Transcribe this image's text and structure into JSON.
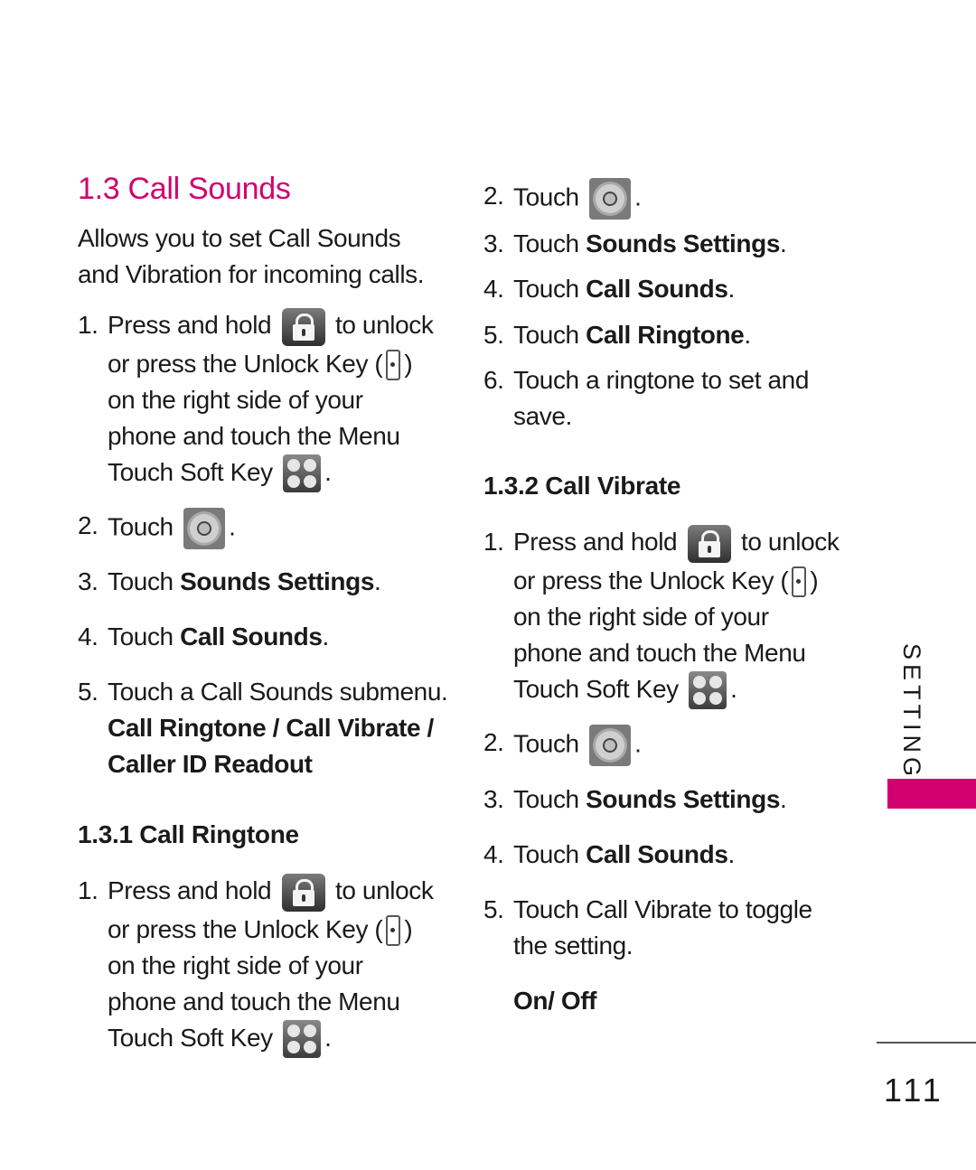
{
  "page": {
    "title": "1.3 Call Sounds",
    "intro": [
      "Allows you to set Call Sounds",
      "and Vibration for incoming calls."
    ],
    "left_steps": {
      "s1": {
        "num": "1.",
        "a": "Press and hold",
        "b": "to unlock",
        "c": "or press the Unlock Key (",
        "d": ")",
        "e": "on the right side of your",
        "f": "phone and touch the Menu",
        "g": "Touch Soft Key",
        "h": "."
      },
      "s2": {
        "num": "2.",
        "text": "Touch",
        "end": "."
      },
      "s3": {
        "num": "3.",
        "pre": "Touch ",
        "bold": "Sounds Settings",
        "end": "."
      },
      "s4": {
        "num": "4.",
        "pre": "Touch ",
        "bold": "Call Sounds",
        "end": "."
      },
      "s5": {
        "num": "5.",
        "text": "Touch a Call Sounds submenu.",
        "bold1": "Call Ringtone / Call Vibrate /",
        "bold2": "Caller ID Readout"
      }
    },
    "sub1": {
      "title": "1.3.1 Call Ringtone",
      "s1": {
        "num": "1.",
        "a": "Press and hold",
        "b": "to unlock",
        "c": "or press the Unlock Key (",
        "d": ")",
        "e": "on the right side of your",
        "f": "phone and touch the Menu",
        "g": "Touch Soft Key",
        "h": "."
      },
      "s2": {
        "num": "2.",
        "text": "Touch",
        "end": "."
      },
      "s3": {
        "num": "3.",
        "pre": "Touch ",
        "bold": "Sounds Settings",
        "end": "."
      },
      "s4": {
        "num": "4.",
        "pre": "Touch ",
        "bold": "Call Sounds",
        "end": "."
      },
      "s5": {
        "num": "5.",
        "pre": "Touch ",
        "bold": "Call Ringtone",
        "end": "."
      },
      "s6": {
        "num": "6.",
        "a": "Touch a ringtone to set and",
        "b": "save."
      }
    },
    "sub2": {
      "title": "1.3.2 Call Vibrate",
      "s1": {
        "num": "1.",
        "a": "Press and hold",
        "b": "to unlock",
        "c": "or press the Unlock Key (",
        "d": ")",
        "e": "on the right side of your",
        "f": "phone and touch the Menu",
        "g": "Touch Soft Key",
        "h": "."
      },
      "s2": {
        "num": "2.",
        "text": "Touch",
        "end": "."
      },
      "s3": {
        "num": "3.",
        "pre": "Touch ",
        "bold": "Sounds Settings",
        "end": "."
      },
      "s4": {
        "num": "4.",
        "pre": "Touch ",
        "bold": "Call Sounds",
        "end": "."
      },
      "s5": {
        "num": "5.",
        "a": "Touch Call Vibrate to toggle",
        "b": "the setting."
      },
      "options": "On/ Off"
    },
    "side_tab": "SETTINGS",
    "page_number": "111",
    "accent_color": "#d2006e",
    "icons": [
      "lock-icon",
      "unlock-key-icon",
      "menu-icon",
      "settings-gear-icon"
    ]
  }
}
